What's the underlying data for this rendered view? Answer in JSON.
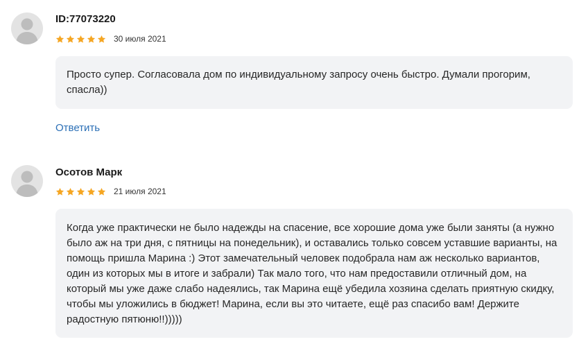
{
  "reviews": [
    {
      "author": "ID:77073220",
      "rating": 5,
      "date": "30 июля 2021",
      "text": "Просто супер. Согласовала дом по индивидуальному запросу очень быстро. Думали прогорим, спасла))",
      "reply_label": "Ответить"
    },
    {
      "author": "Осотов Марк",
      "rating": 5,
      "date": "21 июля 2021",
      "text": "Когда уже практически не было надежды на спасение, все хорошие дома уже были заняты (а нужно было аж на три дня, с пятницы на понедельник), и оставались только совсем уставшие варианты, на помощь пришла Марина :) Этот замечательный человек подобрала нам аж несколько вариантов, один из которых мы в итоге и забрали) Так мало того, что нам предоставили отличный дом, на который мы уже даже слабо надеялись, так Марина ещё убедила хозяина сделать приятную скидку, чтобы мы уложились в бюджет! Марина, если вы это читаете, ещё раз спасибо вам! Держите радостную пятюню!!)))))"
    }
  ],
  "colors": {
    "star": "#f5a623",
    "link": "#2b6fb6",
    "bubble": "#f2f3f5",
    "avatar_bg": "#e3e3e3",
    "avatar_fg": "#bdbdbd"
  },
  "icons": {
    "avatar": "user-silhouette",
    "star": "star-filled"
  }
}
